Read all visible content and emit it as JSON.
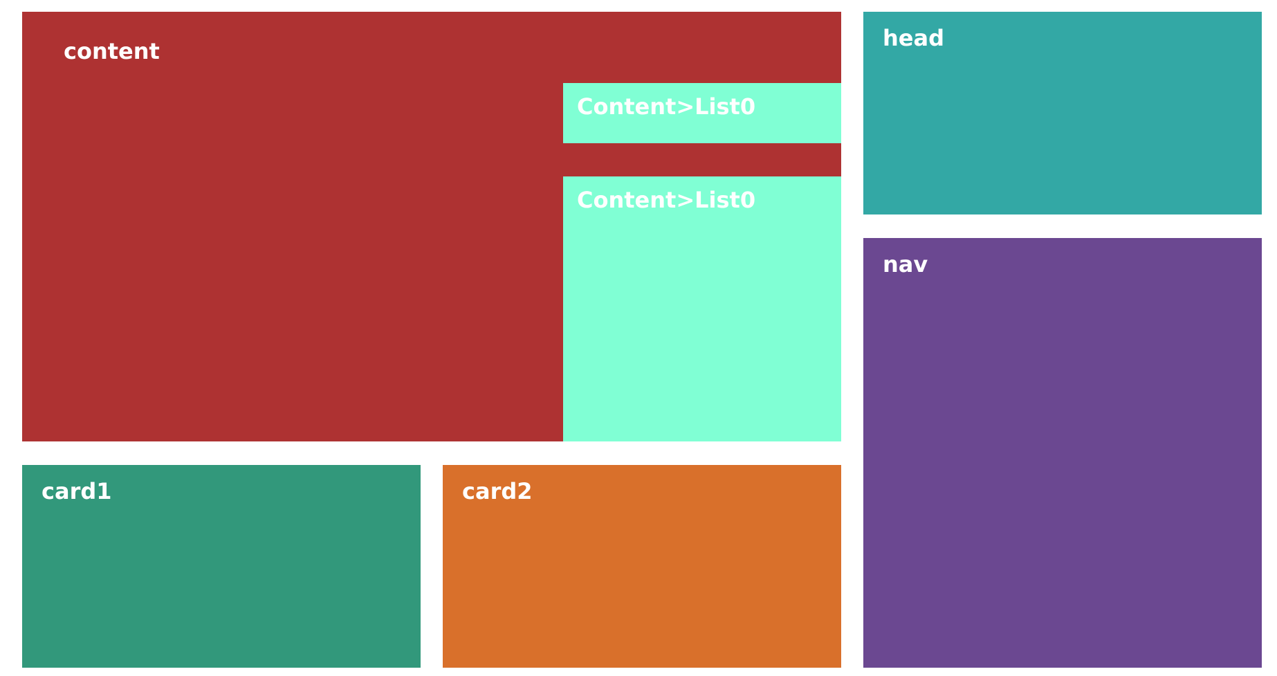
{
  "panels": {
    "content": {
      "label": "content",
      "color": "#ae3232"
    },
    "content_list_a": {
      "label": "Content>List0",
      "color": "#80ffd4"
    },
    "content_list_b": {
      "label": "Content>List0",
      "color": "#80ffd4"
    },
    "head": {
      "label": "head",
      "color": "#33a8a5"
    },
    "nav": {
      "label": "nav",
      "color": "#6b4891"
    },
    "card1": {
      "label": "card1",
      "color": "#32987b"
    },
    "card2": {
      "label": "card2",
      "color": "#d9702b"
    }
  }
}
